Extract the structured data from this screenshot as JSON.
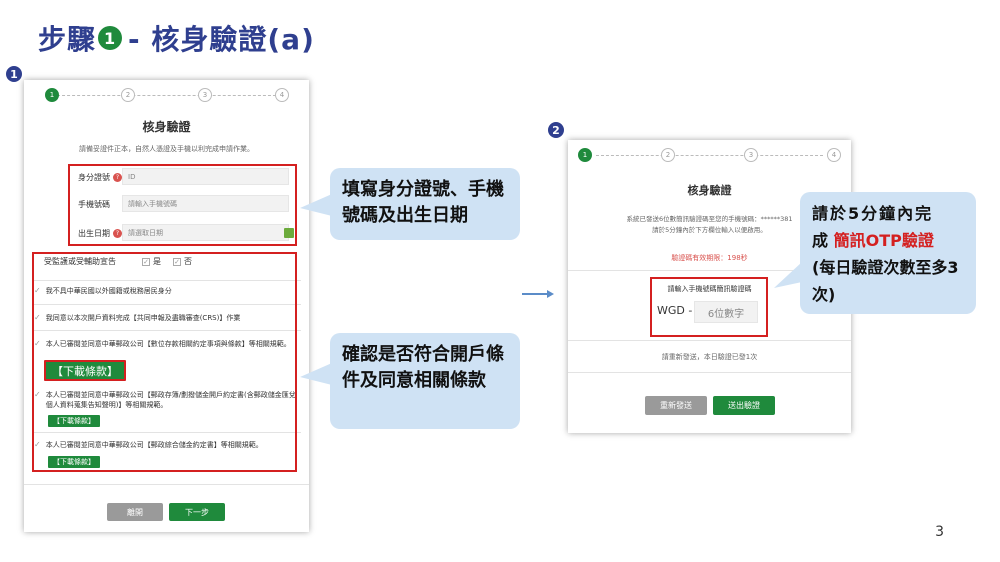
{
  "slide": {
    "title_prefix": "步驟",
    "title_badge": "1",
    "title_suffix": " - 核身驗證(a)",
    "marker1": "1",
    "marker2": "2",
    "page_number": "3"
  },
  "screen1": {
    "steps": [
      "1",
      "2",
      "3",
      "4"
    ],
    "heading": "核身驗證",
    "instruction": "請備妥證件正本，自然人憑證及手機以利完成申請作業。",
    "id_label": "身分證號",
    "id_placeholder": "ID",
    "phone_label": "手機號碼",
    "phone_placeholder": "請輸入手機號碼",
    "birth_label": "出生日期",
    "birth_placeholder": "請選取日期",
    "guardian_label": "受監護或受輔助宣告",
    "yes_label": "是",
    "no_label": "否",
    "agree_items": [
      "我不具中華民國以外國籍或稅務居民身分",
      "我同意以本次開戶資料完成【共同申報及盡職審查(CRS)】作業",
      "本人已審閱並同意中華郵政公司【數位存款相關約定事項與條款】等相關規範。",
      "本人已審閱並同意中華郵政公司【郵政存簿/劃撥儲金開戶約定書(含郵政儲金匯兌個人資料蒐集告知聲明)】等相關規範。",
      "本人已審閱並同意中華郵政公司【郵政綜合儲金約定書】等相關規範。"
    ],
    "download_big": "【下載條款】",
    "download_small": "【下載條款】",
    "leave_button": "離開",
    "next_button": "下一步"
  },
  "callout1": {
    "text": "填寫身分證號、手機號碼及出生日期"
  },
  "callout2": {
    "text": "確認是否符合開戶條件及同意相關條款"
  },
  "screen2": {
    "steps": [
      "1",
      "2",
      "3",
      "4"
    ],
    "heading": "核身驗證",
    "sent_line1": "系統已發送6位數簡訊驗證碼至您的手機號碼：******381",
    "sent_line2": "請於5分鐘內於下方欄位輸入以便啟用。",
    "timer": "驗證碼有效期限：198秒",
    "otp_prompt": "請輸入手機號碼簡訊驗證碼",
    "otp_prefix": "WGD -",
    "otp_placeholder": "6位數字",
    "resend_note": "請重新發送，本日驗證已發1次",
    "resend_button": "重新發送",
    "submit_button": "送出驗證"
  },
  "callout3": {
    "line1": "請於5分鐘內完",
    "line2_plain": "成",
    "line2_highlight": "簡訊OTP驗證",
    "line3": "(每日驗證次數至多3次)"
  },
  "colors": {
    "title": "#2f3f8f",
    "highlight_red": "#d42020",
    "primary_green": "#1f8a3c",
    "callout_bg": "#cfe2f4"
  }
}
